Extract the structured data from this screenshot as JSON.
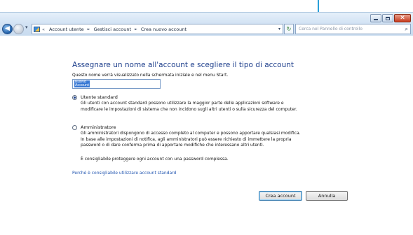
{
  "window": {
    "caption": {
      "minimize_icon": "minimize-icon",
      "maximize_icon": "maximize-icon",
      "close_glyph": "✕"
    }
  },
  "nav": {
    "back_glyph": "◀",
    "history_glyph": "▾"
  },
  "address": {
    "lead": "«",
    "crumbs": [
      "Account utente",
      "Gestisci account",
      "Crea nuovo account"
    ],
    "separator": "►",
    "dropdown": "▾",
    "refresh": "↻"
  },
  "search": {
    "placeholder": "Cerca nel Pannello di controllo",
    "icon": "⌕"
  },
  "page": {
    "title": "Assegnare un nome all'account e scegliere il tipo di account",
    "name_description": "Questo nome verrà visualizzato nella schermata iniziale e nel menu Start.",
    "name_value": "Nuovo\nAccount"
  },
  "options": {
    "standard": {
      "label": "Utente standard",
      "checked": true,
      "description": [
        "Gli utenti con account standard possono utilizzare la maggior parte delle applicazioni software e",
        "modificare le impostazioni di sistema che non incidono sugli altri utenti o sulla sicurezza del computer."
      ]
    },
    "admin": {
      "label": "Amministratore",
      "checked": false,
      "description": [
        "Gli amministratori dispongono di accesso completo al computer e possono apportare qualsiasi modifica.",
        "In base alle impostazioni di notifica, agli amministratori può essere richiesto di immettere la propria",
        "password o di dare conferma prima di apportare modifiche che interessano altri utenti."
      ]
    }
  },
  "advice": "È consigliabile proteggere ogni account con una password complessa.",
  "help_link": "Perché è consigliabile utilizzare account standard",
  "buttons": {
    "create": "Crea account",
    "cancel": "Annulla"
  },
  "colors": {
    "accent": "#2a9fd9",
    "title_blue": "#1e3f8c",
    "link_blue": "#2155b0"
  }
}
